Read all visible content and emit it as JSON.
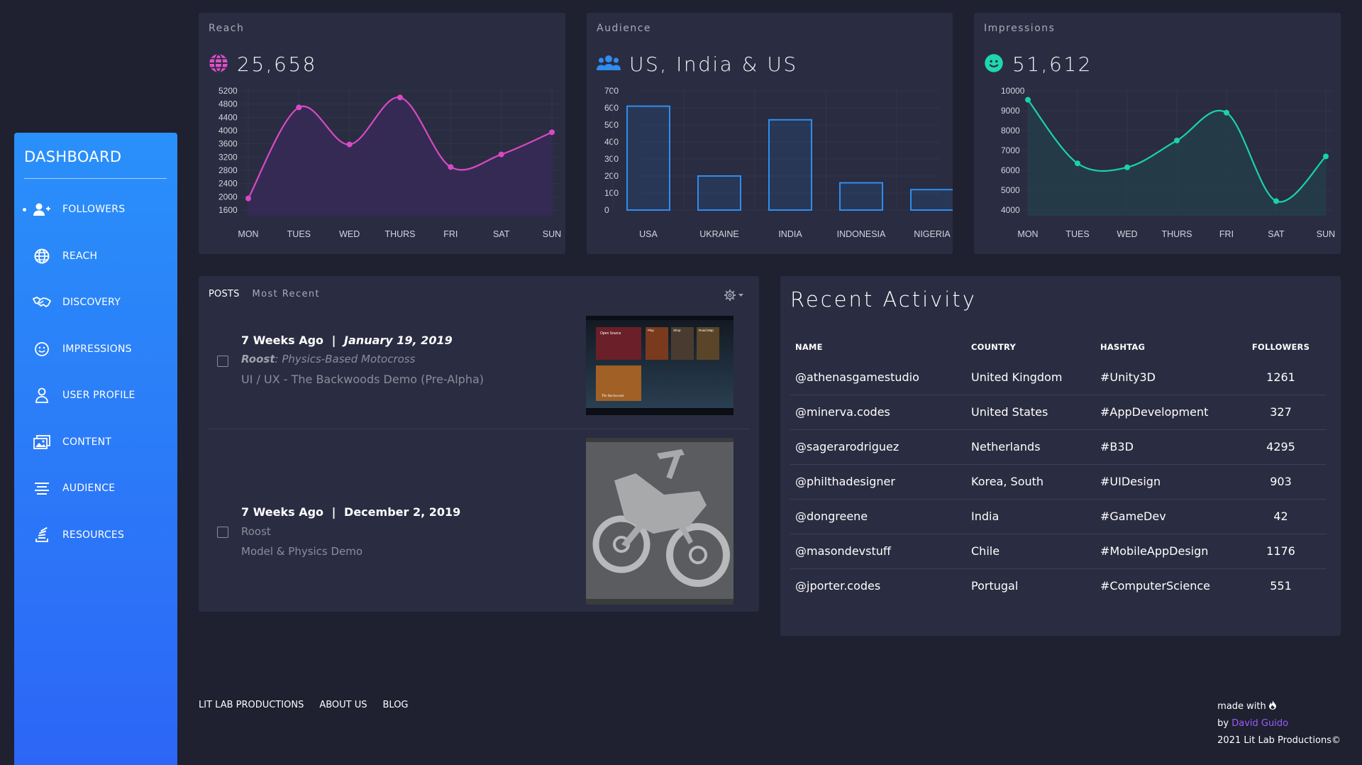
{
  "sidebar": {
    "title": "DASHBOARD",
    "items": [
      {
        "label": "FOLLOWERS",
        "icon": "user-plus-icon",
        "active": true
      },
      {
        "label": "REACH",
        "icon": "globe-icon"
      },
      {
        "label": "DISCOVERY",
        "icon": "handshake-icon"
      },
      {
        "label": "IMPRESSIONS",
        "icon": "smile-icon"
      },
      {
        "label": "USER PROFILE",
        "icon": "user-icon"
      },
      {
        "label": "CONTENT",
        "icon": "images-icon"
      },
      {
        "label": "AUDIENCE",
        "icon": "list-icon"
      },
      {
        "label": "RESOURCES",
        "icon": "stack-icon"
      }
    ]
  },
  "cards": {
    "reach": {
      "label": "Reach",
      "value": "25,658",
      "icon": "globe-icon",
      "color": "#e04fc8"
    },
    "audience": {
      "label": "Audience",
      "value": "US, India & US",
      "icon": "users-icon",
      "color": "#2f8cf0"
    },
    "impressions": {
      "label": "Impressions",
      "value": "51,612",
      "icon": "smile-icon",
      "color": "#1ed8ad"
    }
  },
  "chart_data": [
    {
      "type": "line",
      "categories": [
        "MON",
        "TUES",
        "WED",
        "THURS",
        "FRI",
        "SAT",
        "SUN"
      ],
      "values": [
        1950,
        4700,
        3580,
        5000,
        2900,
        3280,
        3950
      ],
      "yticks": [
        1600,
        2000,
        2400,
        2800,
        3200,
        3600,
        4000,
        4400,
        4800,
        5200
      ],
      "ylim": [
        1600,
        5200
      ],
      "color": "#d84ac4",
      "fill": "#3a2a5a"
    },
    {
      "type": "bar",
      "categories": [
        "USA",
        "UKRAINE",
        "INDIA",
        "INDONESIA",
        "NIGERIA"
      ],
      "values": [
        610,
        200,
        530,
        160,
        120
      ],
      "yticks": [
        0,
        100,
        200,
        300,
        400,
        500,
        600,
        700
      ],
      "ylim": [
        0,
        700
      ],
      "color": "#2d8ef0"
    },
    {
      "type": "line",
      "categories": [
        "MON",
        "TUES",
        "WED",
        "THURS",
        "FRI",
        "SAT",
        "SUN"
      ],
      "values": [
        9550,
        6350,
        6150,
        7500,
        8900,
        4450,
        6700
      ],
      "yticks": [
        4000,
        5000,
        6000,
        7000,
        8000,
        9000,
        10000
      ],
      "ylim": [
        4000,
        10000
      ],
      "color": "#19d3a8",
      "fill": "#23404a"
    }
  ],
  "posts": {
    "title": "POSTS",
    "subtitle": "Most Recent",
    "items": [
      {
        "ago": "7 Weeks Ago",
        "sep": "|",
        "date": "January 19, 2019",
        "line1_bold": "Roost",
        "line1_rest": ": Physics-Based Motocross",
        "line2": "UI / UX - The Backwoods Demo (Pre-Alpha)",
        "thumb": "game-ui-screenshot",
        "thumb_titles": [
          "Open Source",
          "Play",
          "Shop",
          "Road Map",
          "The Backwoods"
        ]
      },
      {
        "ago": "7 Weeks Ago",
        "sep": "|",
        "date": "December 2, 2019",
        "line1_bold": "Roost",
        "line1_rest": "",
        "line2": "Model & Physics Demo",
        "thumb": "motorcycle-3d-model"
      }
    ]
  },
  "activity": {
    "title": "Recent Activity",
    "columns": [
      "NAME",
      "COUNTRY",
      "HASHTAG",
      "FOLLOWERS"
    ],
    "rows": [
      [
        "@athenasgamestudio",
        "United Kingdom",
        "#Unity3D",
        "1261"
      ],
      [
        "@minerva.codes",
        "United States",
        "#AppDevelopment",
        "327"
      ],
      [
        "@sagerarodriguez",
        "Netherlands",
        "#B3D",
        "4295"
      ],
      [
        "@philthadesigner",
        "Korea, South",
        "#UIDesign",
        "903"
      ],
      [
        "@dongreene",
        "India",
        "#GameDev",
        "42"
      ],
      [
        "@masondevstuff",
        "Chile",
        "#MobileAppDesign",
        "1176"
      ],
      [
        "@jporter.codes",
        "Portugal",
        "#ComputerScience",
        "551"
      ]
    ]
  },
  "footer": {
    "links": [
      "LIT LAB PRODUCTIONS",
      "ABOUT US",
      "BLOG"
    ],
    "made_with": "made with",
    "by": "by",
    "author": "David Guido",
    "copyright": "2021 Lit Lab Productions©"
  }
}
